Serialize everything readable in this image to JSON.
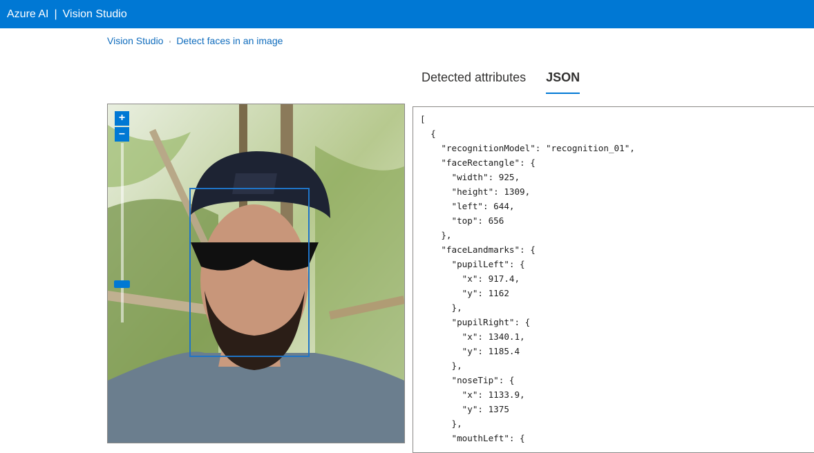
{
  "header": {
    "brand": "Azure AI",
    "separator": "|",
    "product": "Vision Studio"
  },
  "breadcrumb": {
    "root": "Vision Studio",
    "current": "Detect faces in an image"
  },
  "tabs": [
    {
      "label": "Detected attributes",
      "active": false
    },
    {
      "label": "JSON",
      "active": true
    }
  ],
  "viewer": {
    "zoom_in": "+",
    "zoom_out": "–"
  },
  "json_lines": [
    "[",
    "  {",
    "    \"recognitionModel\": \"recognition_01\",",
    "    \"faceRectangle\": {",
    "      \"width\": 925,",
    "      \"height\": 1309,",
    "      \"left\": 644,",
    "      \"top\": 656",
    "    },",
    "    \"faceLandmarks\": {",
    "      \"pupilLeft\": {",
    "        \"x\": 917.4,",
    "        \"y\": 1162",
    "      },",
    "      \"pupilRight\": {",
    "        \"x\": 1340.1,",
    "        \"y\": 1185.4",
    "      },",
    "      \"noseTip\": {",
    "        \"x\": 1133.9,",
    "        \"y\": 1375",
    "      },",
    "      \"mouthLeft\": {"
  ],
  "colors": {
    "accent": "#0078d4",
    "link": "#0f6cbd"
  }
}
